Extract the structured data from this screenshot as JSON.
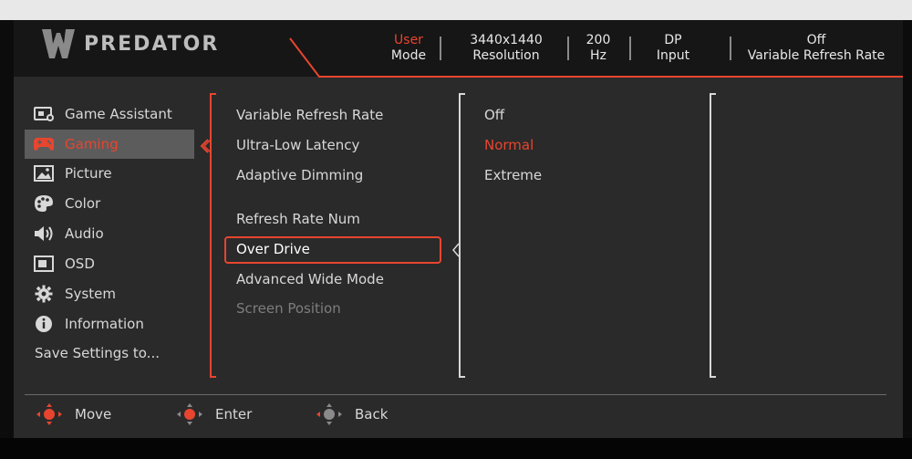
{
  "header": {
    "brand": "PREDATOR",
    "info": [
      {
        "top": "User",
        "bottom": "Mode",
        "top_color": "#e8452f"
      },
      {
        "top": "3440x1440",
        "bottom": "Resolution"
      },
      {
        "top": "200",
        "bottom": "Hz"
      },
      {
        "top": "DP",
        "bottom": "Input"
      },
      {
        "top": "Off",
        "bottom": "Variable Refresh Rate"
      }
    ]
  },
  "menu": {
    "items": [
      {
        "label": "Game Assistant",
        "icon": "game-assistant-icon"
      },
      {
        "label": "Gaming",
        "icon": "gamepad-icon",
        "active": true
      },
      {
        "label": "Picture",
        "icon": "picture-icon"
      },
      {
        "label": "Color",
        "icon": "palette-icon"
      },
      {
        "label": "Audio",
        "icon": "speaker-icon"
      },
      {
        "label": "OSD",
        "icon": "osd-icon"
      },
      {
        "label": "System",
        "icon": "gear-icon"
      },
      {
        "label": "Information",
        "icon": "info-icon"
      }
    ],
    "save": "Save Settings to..."
  },
  "submenu": {
    "items": [
      {
        "label": "Variable Refresh Rate"
      },
      {
        "label": "Ultra-Low Latency"
      },
      {
        "label": "Adaptive Dimming"
      },
      {
        "label": "Refresh Rate Num"
      },
      {
        "label": "Over Drive",
        "selected": true
      },
      {
        "label": "Advanced Wide Mode"
      },
      {
        "label": "Screen Position",
        "disabled": true
      }
    ]
  },
  "options": {
    "items": [
      {
        "label": "Off"
      },
      {
        "label": "Normal",
        "active": true
      },
      {
        "label": "Extreme"
      }
    ]
  },
  "footer": {
    "move": "Move",
    "enter": "Enter",
    "back": "Back"
  },
  "colors": {
    "accent": "#e8452f",
    "panel": "#2a2a2a",
    "header": "#161616",
    "active_bg": "#5c5c5c"
  }
}
